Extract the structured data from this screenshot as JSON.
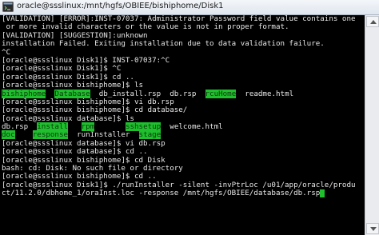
{
  "window": {
    "title": "oracle@ssslinux:/mnt/hgfs/OBIEE/bishiphome/Disk1"
  },
  "colors": {
    "terminal_bg": "#000000",
    "terminal_fg": "#e8e8e8",
    "highlight_bg": "#1fbf2e",
    "titlebar_bg": "#e6ecf2"
  },
  "icons": {
    "app": "terminal-app-icon",
    "scroll_up": "scroll-up-arrow-icon",
    "scroll_down": "scroll-down-arrow-icon"
  },
  "lines": [
    [
      {
        "t": "[VALIDATION] [ERROR]:INST-07037: Administrator Password field value contains one"
      }
    ],
    [
      {
        "t": " or more invalid characters or the value is not in proper format."
      }
    ],
    [
      {
        "t": "[VALIDATION] [SUGGESTION]:unknown"
      }
    ],
    [
      {
        "t": "installation Failed. Exiting installation due to data validation failure."
      }
    ],
    [
      {
        "t": "^C"
      }
    ],
    [
      {
        "t": "[oracle@ssslinux Disk1]$ INST-07037:^C"
      }
    ],
    [
      {
        "t": "[oracle@ssslinux Disk1]$ ^C"
      }
    ],
    [
      {
        "t": "[oracle@ssslinux Disk1]$ cd .."
      }
    ],
    [
      {
        "t": "[oracle@ssslinux bishiphome]$ ls"
      }
    ],
    [
      {
        "t": "bishiphome",
        "h": true
      },
      {
        "t": "  "
      },
      {
        "t": "Database",
        "h": true
      },
      {
        "t": "  db_install.rsp  db.rsp  "
      },
      {
        "t": "rcuHome",
        "h": true
      },
      {
        "t": "  readme.html"
      }
    ],
    [
      {
        "t": "[oracle@ssslinux bishiphome]$ vi db.rsp"
      }
    ],
    [
      {
        "t": "[oracle@ssslinux bishiphome]$ cd database/"
      }
    ],
    [
      {
        "t": "[oracle@ssslinux database]$ ls"
      }
    ],
    [
      {
        "t": "db.rsp  "
      },
      {
        "t": "install",
        "h": true
      },
      {
        "t": "   "
      },
      {
        "t": "rpm",
        "h": true
      },
      {
        "t": "       "
      },
      {
        "t": "sshsetup",
        "h": true
      },
      {
        "t": "  welcome.html"
      }
    ],
    [
      {
        "t": "doc",
        "h": true
      },
      {
        "t": "    "
      },
      {
        "t": "response",
        "h": true
      },
      {
        "t": "  runInstaller  "
      },
      {
        "t": "stage",
        "h": true
      }
    ],
    [
      {
        "t": "[oracle@ssslinux database]$ vi db.rsp"
      }
    ],
    [
      {
        "t": "[oracle@ssslinux database]$ cd .."
      }
    ],
    [
      {
        "t": "[oracle@ssslinux bishiphome]$ cd Disk"
      }
    ],
    [
      {
        "t": "bash: cd: Disk: No such file or directory"
      }
    ],
    [
      {
        "t": "[oracle@ssslinux bishiphome]$ cd .."
      }
    ],
    [
      {
        "t": "[oracle@ssslinux Disk1]$ ./runInstaller -silent -invPtrLoc /u01/app/oracle/produ"
      }
    ],
    [
      {
        "t": "ct/11.2.0/dbhome_1/oraInst.loc -response /mnt/hgfs/OBIEE/database/db.rsp"
      },
      {
        "cursor": true
      }
    ]
  ]
}
